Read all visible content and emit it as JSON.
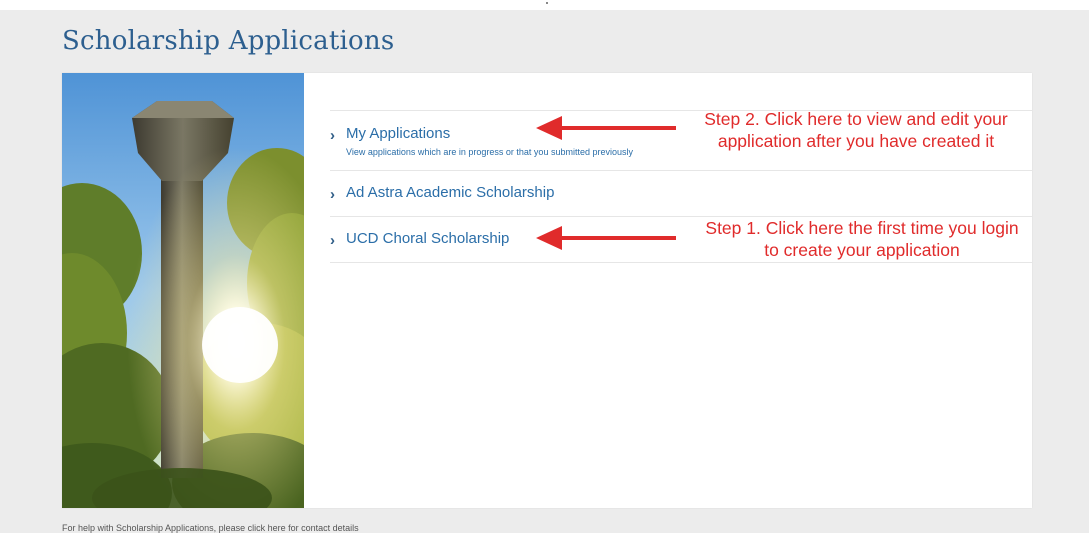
{
  "page": {
    "title": "Scholarship Applications",
    "footer_text": "For help with Scholarship Applications, please click here for contact details"
  },
  "menu": {
    "items": [
      {
        "label": "My Applications",
        "description": "View applications which are in progress or that you submitted previously"
      },
      {
        "label": "Ad Astra Academic Scholarship"
      },
      {
        "label": "UCD Choral Scholarship"
      }
    ],
    "chevron": "›"
  },
  "annotations": {
    "step2": [
      "Step 2. Click here to view and edit your",
      "application after you have created it"
    ],
    "step1": [
      "Step 1. Click here the first time you login",
      "to create your application"
    ]
  },
  "colors": {
    "title": "#2d5f8f",
    "link": "#2b6ea8",
    "annotation": "#e02b2b",
    "background": "#ececec",
    "card": "#ffffff"
  },
  "icons": {
    "chevron": "chevron-right-icon",
    "arrow": "arrow-left-icon"
  }
}
